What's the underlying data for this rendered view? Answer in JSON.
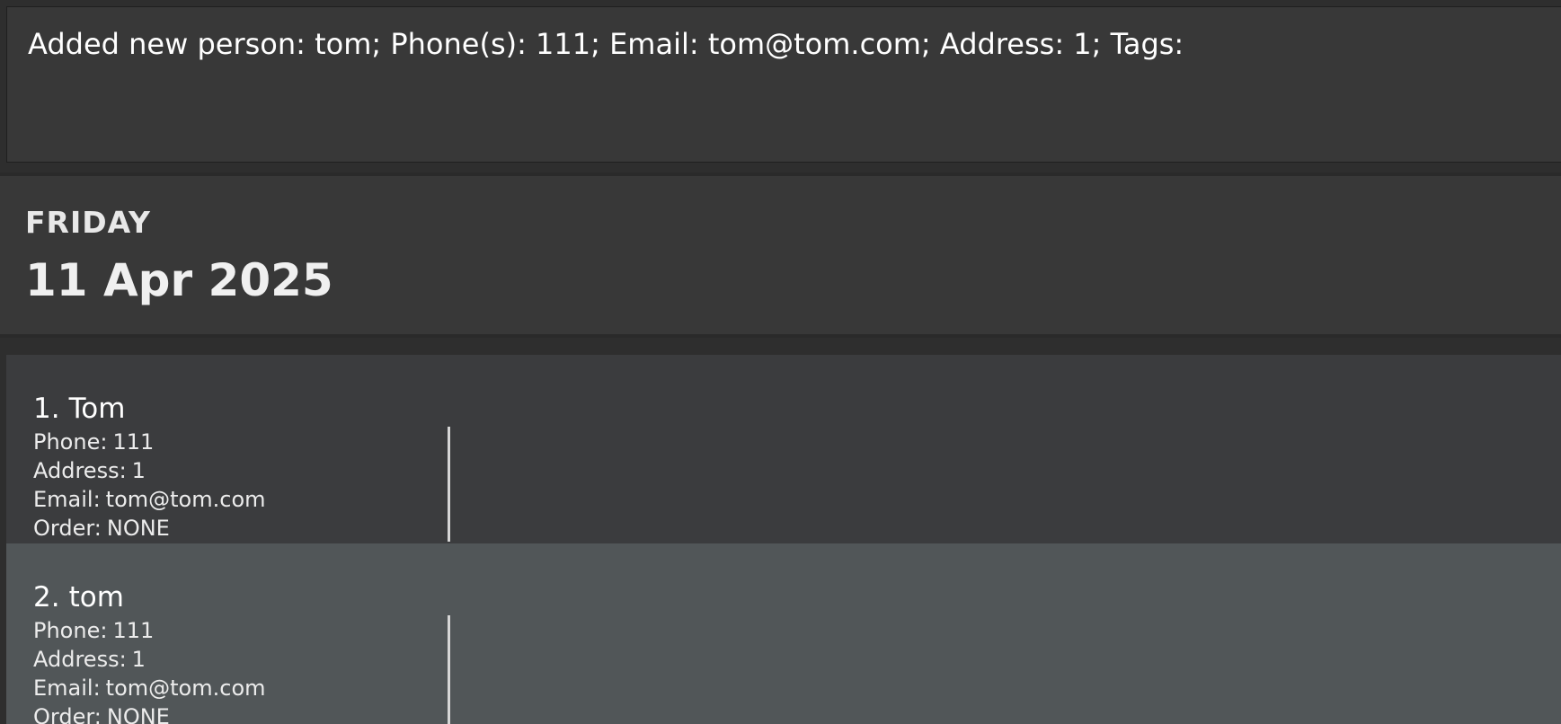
{
  "result_display": {
    "text": "Added new person: tom; Phone(s): 111; Email: tom@tom.com; Address: 1; Tags:"
  },
  "date_header": {
    "day": "FRIDAY",
    "date": "11 Apr 2025"
  },
  "person_list": [
    {
      "index": "1.",
      "name": "Tom",
      "phone_label": "Phone:",
      "phone": "111",
      "address_label": "Address:",
      "address": "1",
      "email_label": "Email:",
      "email": "tom@tom.com",
      "order_label": "Order:",
      "order": "NONE"
    },
    {
      "index": "2.",
      "name": "tom",
      "phone_label": "Phone:",
      "phone": "111",
      "address_label": "Address:",
      "address": "1",
      "email_label": "Email:",
      "email": "tom@tom.com",
      "order_label": "Order:",
      "order": "NONE"
    }
  ],
  "colors": {
    "background": "#2e2e2e",
    "panel": "#383838",
    "card_odd": "#3b3c3e",
    "card_even": "#515658",
    "text": "#ffffff"
  }
}
